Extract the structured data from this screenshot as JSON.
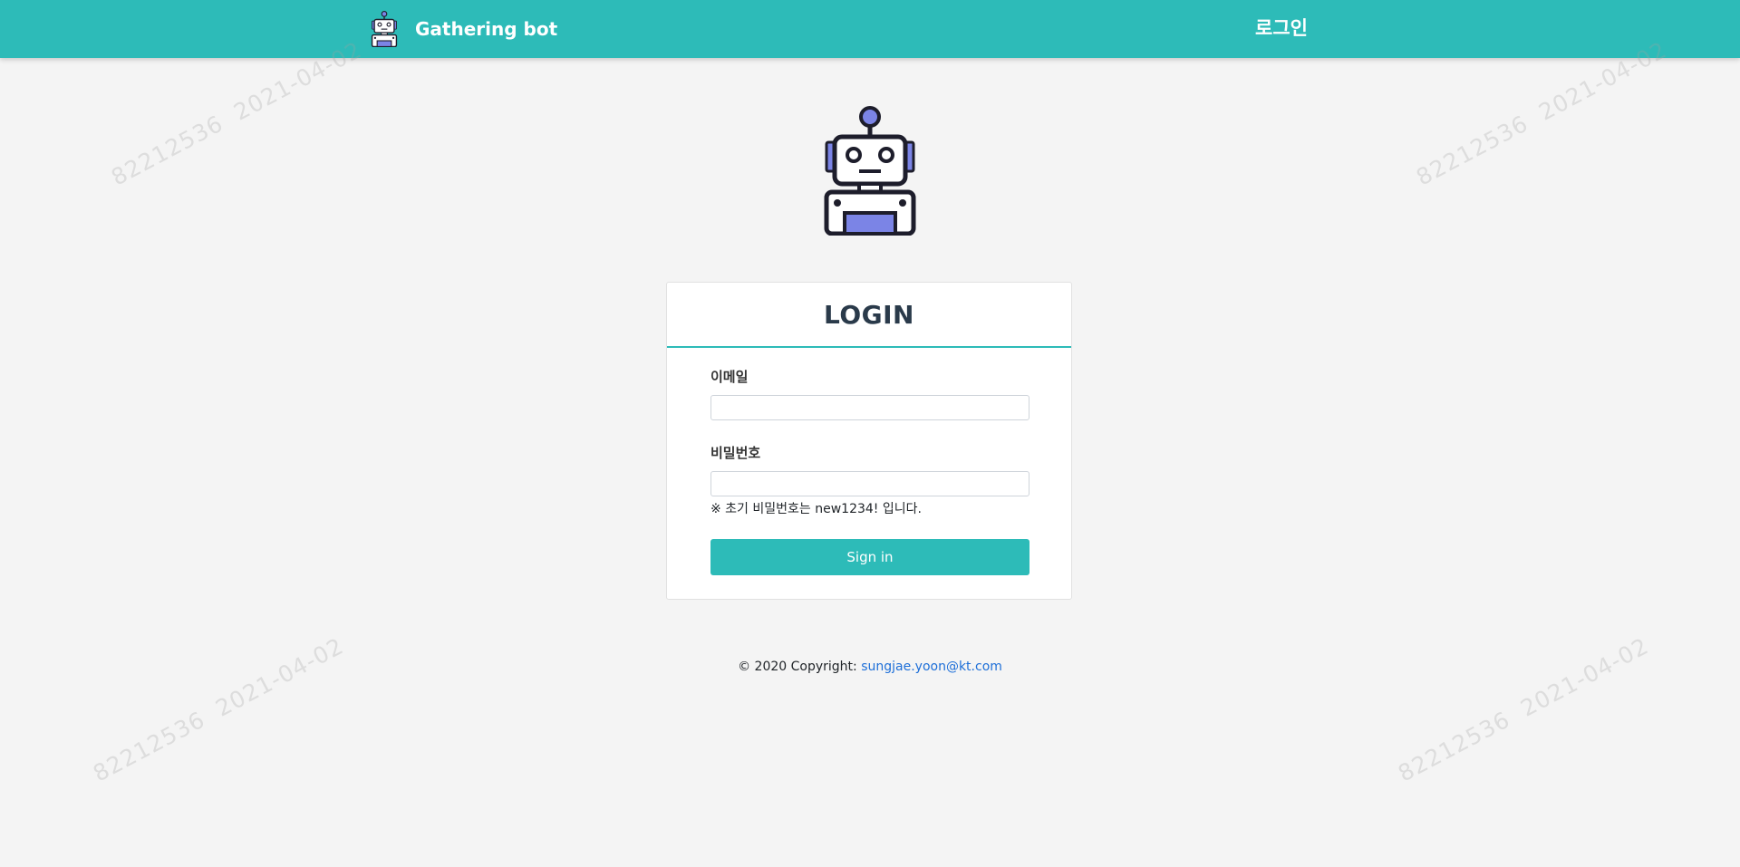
{
  "header": {
    "brand_name": "Gathering bot",
    "nav_login_label": "로그인",
    "brand_icon": "robot-icon",
    "accent_color": "#2dbbb8"
  },
  "hero": {
    "icon": "robot-icon"
  },
  "login_card": {
    "title": "LOGIN",
    "email_label": "이메일",
    "email_value": "",
    "password_label": "비밀번호",
    "password_value": "",
    "password_hint": "※ 초기 비밀번호는 new1234! 입니다.",
    "signin_label": "Sign in"
  },
  "footer": {
    "copyright_text": "© 2020 Copyright: ",
    "contact_email": "sungjae.yoon@kt.com"
  },
  "watermark": {
    "id_text": "82212536",
    "date_text": "2021-04-02"
  }
}
